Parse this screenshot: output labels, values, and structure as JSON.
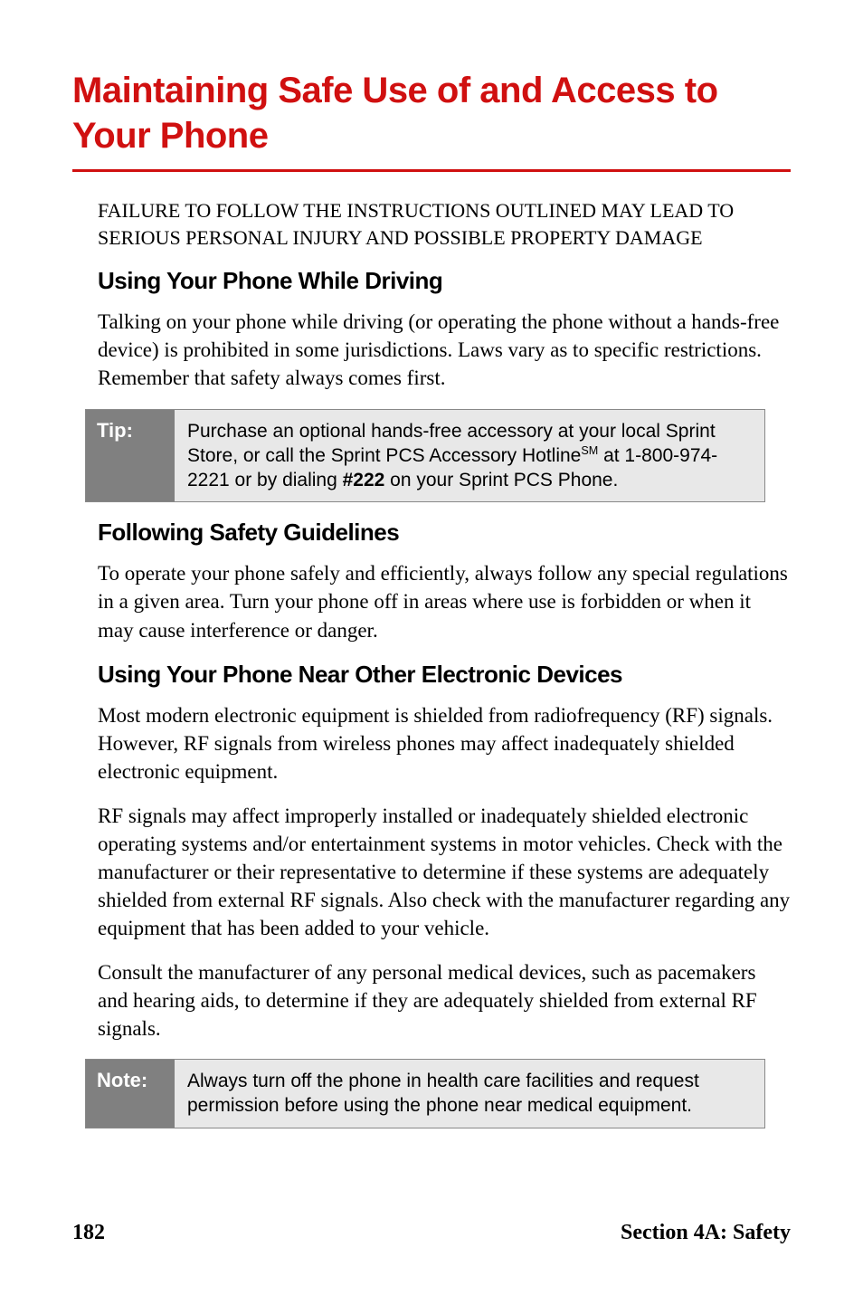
{
  "title": "Maintaining Safe Use of and Access to Your Phone",
  "intro": "FAILURE TO FOLLOW THE INSTRUCTIONS OUTLINED MAY LEAD TO SERIOUS PERSONAL INJURY AND POSSIBLE PROPERTY DAMAGE",
  "sections": {
    "driving": {
      "heading": "Using Your Phone While Driving",
      "body": "Talking on your phone while driving (or operating the phone without a hands-free device) is prohibited in some jurisdictions. Laws vary as to specific restrictions. Remember that safety always comes first."
    },
    "tip": {
      "label": "Tip:",
      "body_pre": "Purchase an optional hands-free accessory at your local Sprint Store, or call the Sprint PCS Accessory Hotline",
      "body_sm": "SM",
      "body_mid": " at 1-800-974-2221 or by dialing ",
      "body_bold": "#222",
      "body_post": " on your Sprint PCS Phone."
    },
    "guidelines": {
      "heading": "Following Safety Guidelines",
      "body": "To operate your phone safely and efficiently, always follow any special regulations in a given area. Turn your phone off in areas where use is forbidden or when it may cause interference or danger."
    },
    "electronics": {
      "heading": "Using Your Phone Near Other Electronic Devices",
      "p1": "Most modern electronic equipment is shielded from radiofrequency (RF) signals. However, RF signals from wireless phones may affect inadequately shielded electronic equipment.",
      "p2": "RF signals may affect improperly installed or inadequately shielded electronic operating systems and/or entertainment systems in motor vehicles. Check with the manufacturer or their representative to determine if these systems are adequately shielded from external RF signals. Also check with the manufacturer regarding any equipment that has been added to your vehicle.",
      "p3": "Consult the manufacturer of any personal medical devices, such as pacemakers and hearing aids, to determine if they are adequately shielded from external RF signals."
    },
    "note": {
      "label": "Note:",
      "body": "Always turn off the phone in health care facilities and request permission before using the phone near medical equipment."
    }
  },
  "footer": {
    "page": "182",
    "section": "Section 4A: Safety"
  }
}
